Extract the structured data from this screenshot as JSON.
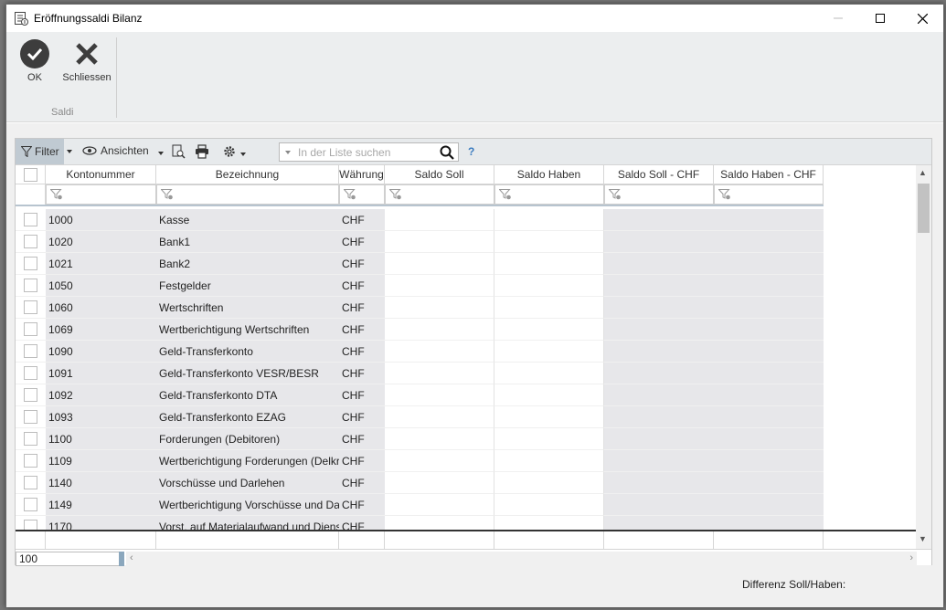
{
  "window": {
    "title": "Eröffnungssaldi Bilanz"
  },
  "ribbon": {
    "ok_label": "OK",
    "close_label": "Schliessen",
    "group_label": "Saldi"
  },
  "toolbar": {
    "filter_label": "Filter",
    "views_label": "Ansichten",
    "search_placeholder": "In der Liste suchen",
    "help_label": "?"
  },
  "table": {
    "columns": [
      "Kontonummer",
      "Bezeichnung",
      "Währung",
      "Saldo Soll",
      "Saldo Haben",
      "Saldo Soll - CHF",
      "Saldo Haben - CHF"
    ],
    "rows": [
      {
        "konto": "1000",
        "bezeichnung": "Kasse",
        "waehrung": "CHF"
      },
      {
        "konto": "1020",
        "bezeichnung": "Bank1",
        "waehrung": "CHF"
      },
      {
        "konto": "1021",
        "bezeichnung": "Bank2",
        "waehrung": "CHF"
      },
      {
        "konto": "1050",
        "bezeichnung": "Festgelder",
        "waehrung": "CHF"
      },
      {
        "konto": "1060",
        "bezeichnung": "Wertschriften",
        "waehrung": "CHF"
      },
      {
        "konto": "1069",
        "bezeichnung": "Wertberichtigung Wertschriften",
        "waehrung": "CHF"
      },
      {
        "konto": "1090",
        "bezeichnung": "Geld-Transferkonto",
        "waehrung": "CHF"
      },
      {
        "konto": "1091",
        "bezeichnung": "Geld-Transferkonto VESR/BESR",
        "waehrung": "CHF"
      },
      {
        "konto": "1092",
        "bezeichnung": "Geld-Transferkonto DTA",
        "waehrung": "CHF"
      },
      {
        "konto": "1093",
        "bezeichnung": "Geld-Transferkonto EZAG",
        "waehrung": "CHF"
      },
      {
        "konto": "1100",
        "bezeichnung": "Forderungen (Debitoren)",
        "waehrung": "CHF"
      },
      {
        "konto": "1109",
        "bezeichnung": "Wertberichtigung Forderungen (Delkreder",
        "waehrung": "CHF"
      },
      {
        "konto": "1140",
        "bezeichnung": "Vorschüsse und Darlehen",
        "waehrung": "CHF"
      },
      {
        "konto": "1149",
        "bezeichnung": "Wertberichtigung Vorschüsse und Darlehe",
        "waehrung": "CHF"
      },
      {
        "konto": "1170",
        "bezeichnung": "Vorst. auf Materialaufwand und Dienstl.",
        "waehrung": "CHF"
      }
    ]
  },
  "footer": {
    "row_count": "100",
    "difference_label": "Differenz Soll/Haben:"
  }
}
